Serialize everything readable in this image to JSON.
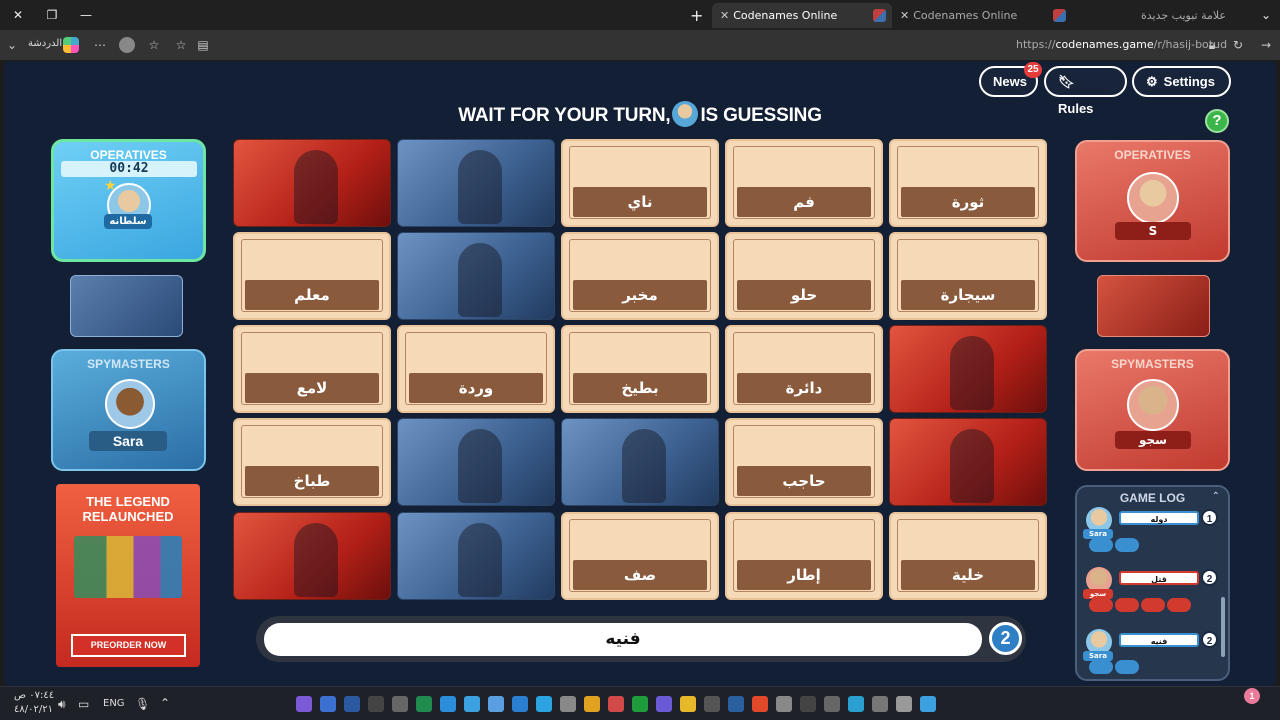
{
  "browser": {
    "tabs": [
      {
        "title": "Codenames Online",
        "active": true
      },
      {
        "title": "Codenames Online",
        "active": false
      },
      {
        "title": "علامة تبويب جديدة",
        "active": false
      }
    ],
    "url_host": "codenames.game",
    "url_prefix": "https://",
    "url_path": "/r/hasij-botud",
    "chat_label": "الدردشة"
  },
  "header": {
    "news_label": "News",
    "news_count": "25",
    "rules_label": "Rules",
    "settings_label": "Settings",
    "help_label": "?"
  },
  "banner": {
    "prefix": "WAIT FOR YOUR TURN,",
    "suffix": "IS GUESSING"
  },
  "blue_team": {
    "operatives_title": "OPERATIVES",
    "timer": "00:42",
    "operative_name": "سلطانه",
    "spymasters_title": "SPYMASTERS",
    "spymaster_name": "Sara"
  },
  "red_team": {
    "operatives_title": "OPERATIVES",
    "operative_name": "S",
    "spymasters_title": "SPYMASTERS",
    "spymaster_name": "سجو"
  },
  "ad": {
    "title_line1": "THE LEGEND",
    "title_line2": "RELAUNCHED",
    "cta": "PREORDER NOW"
  },
  "board": [
    {
      "type": "agent-red",
      "word": ""
    },
    {
      "type": "agent-blue",
      "word": ""
    },
    {
      "type": "word",
      "word": "ناي"
    },
    {
      "type": "word",
      "word": "فم"
    },
    {
      "type": "word",
      "word": "ثورة"
    },
    {
      "type": "word",
      "word": "معلم"
    },
    {
      "type": "agent-blue",
      "word": ""
    },
    {
      "type": "word",
      "word": "مخبر"
    },
    {
      "type": "word",
      "word": "حلو"
    },
    {
      "type": "word",
      "word": "سيجارة"
    },
    {
      "type": "word",
      "word": "لامع"
    },
    {
      "type": "word",
      "word": "وردة"
    },
    {
      "type": "word",
      "word": "بطيخ"
    },
    {
      "type": "word",
      "word": "دائرة"
    },
    {
      "type": "agent-red",
      "word": ""
    },
    {
      "type": "word",
      "word": "طباخ"
    },
    {
      "type": "agent-blue",
      "word": ""
    },
    {
      "type": "agent-blue",
      "word": ""
    },
    {
      "type": "word",
      "word": "حاجب"
    },
    {
      "type": "agent-red",
      "word": ""
    },
    {
      "type": "agent-red",
      "word": ""
    },
    {
      "type": "agent-blue",
      "word": ""
    },
    {
      "type": "word",
      "word": "صف"
    },
    {
      "type": "word",
      "word": "إطار"
    },
    {
      "type": "word",
      "word": "خلية"
    }
  ],
  "clue": {
    "word": "فنيه",
    "number": "2"
  },
  "game_log": {
    "title": "GAME LOG",
    "entries": [
      {
        "who": "Sara",
        "team": "blue",
        "clue": "دوله",
        "number": "1"
      },
      {
        "who": "سجو",
        "team": "red",
        "clue": "قتل",
        "number": "2"
      },
      {
        "who": "Sara",
        "team": "blue",
        "clue": "فنيه",
        "number": "2"
      }
    ]
  },
  "taskbar": {
    "time": "٠٧:٤٤ ص",
    "date": "٤٨/٠٢/٢١",
    "lang": "ENG",
    "notification_count": "1"
  },
  "colors": {
    "red_team": "#c13a30",
    "blue_team": "#3aa6e0",
    "card_beige": "#f6d9b6",
    "card_label": "#8a5a3c"
  }
}
